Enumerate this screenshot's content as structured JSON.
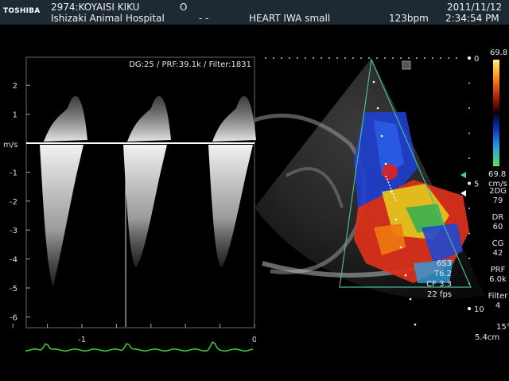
{
  "header": {
    "logo": "TOSHIBA",
    "patient": "2974:KOYAISI  KIKU",
    "patient_mark": "O",
    "hospital": "Ishizaki Animal Hospital",
    "dashes": "- -",
    "preset": "HEART IWA small",
    "heart_rate": "123bpm",
    "date": "2011/11/12",
    "time": "2:34:54 PM"
  },
  "doppler": {
    "settings": "DG:25 /   PRF:39.1k / Filter:1831",
    "velocity_unit": "m/s",
    "y_ticks": [
      "2",
      "1",
      "-1",
      "-2",
      "-3",
      "-4",
      "-5",
      "-6"
    ],
    "x_ticks": [
      "-1",
      "0"
    ]
  },
  "echo": {
    "depth_ticks": [
      "0",
      "5",
      "10"
    ],
    "color_scale_top": "69.8",
    "color_scale_bottom": "69.8",
    "color_scale_unit": "cm/s",
    "params": [
      {
        "label": "2DG",
        "value": "79"
      },
      {
        "label": "DR",
        "value": "60"
      },
      {
        "label": "CG",
        "value": "42"
      },
      {
        "label": "PRF",
        "value": "6.0k"
      },
      {
        "label": "Filter",
        "value": "4"
      }
    ],
    "angle": "15°",
    "gate": "5.4cm",
    "overlay_lines": [
      "6S3",
      "T6.2",
      "CF 3.3",
      "22 fps"
    ],
    "colors": {
      "flow_red": "#d8301a",
      "flow_blue": "#2048d0",
      "flow_yellow": "#e6d21e",
      "trace_green": "#3ccf3c"
    }
  }
}
